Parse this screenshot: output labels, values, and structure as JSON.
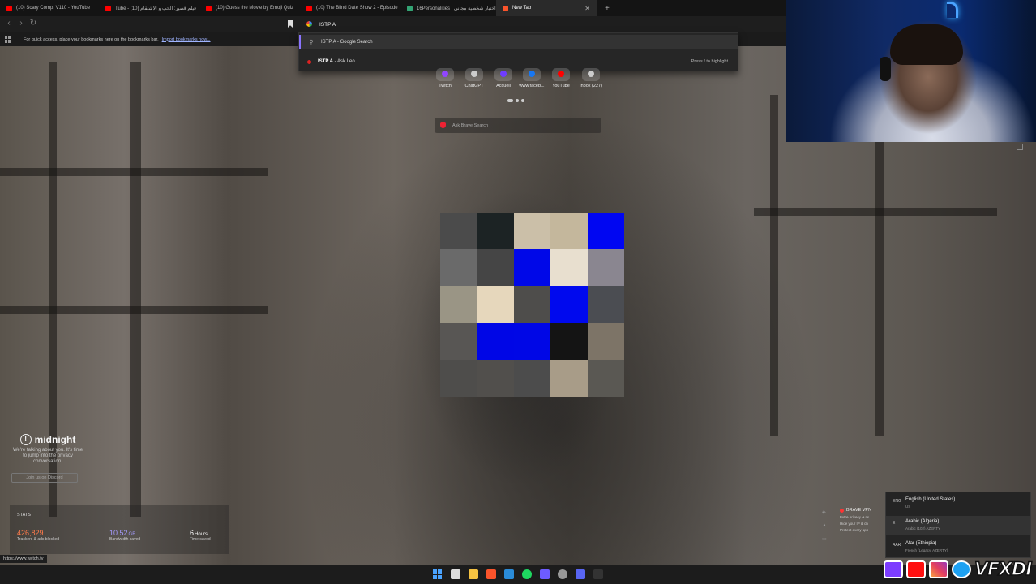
{
  "tabs": [
    {
      "label": "(10) Scary Comp. V110 - YouTube",
      "favicon_color": "#ff0000"
    },
    {
      "label": "Tube - فيلم قصير: الحب و الاشتقام (10)",
      "favicon_color": "#ff0000"
    },
    {
      "label": "(10) Guess the Movie by Emoji Quiz",
      "favicon_color": "#ff0000"
    },
    {
      "label": "(10) The Blind Date Show 2 - Episode",
      "favicon_color": "#ff0000"
    },
    {
      "label": "16Personalities | اختبار شخصية مجاني",
      "favicon_color": "#33a474"
    },
    {
      "label": "New Tab",
      "favicon_color": "#fb542b",
      "active": true
    }
  ],
  "toolbar": {
    "url_value": "ISTP A"
  },
  "bookmarks_bar": {
    "message": "For quick access, place your bookmarks here on the bookmarks bar.",
    "link": "Import bookmarks now..."
  },
  "omnibox": {
    "suggestion_1_bold": "ISTP A",
    "suggestion_1_rest": " - Google Search",
    "suggestion_2_bold": "ISTP A",
    "suggestion_2_rest": " - Ask Leo",
    "hint": "Press ! to highlight"
  },
  "top_sites": [
    {
      "label": "Twitch",
      "color": "#9146ff"
    },
    {
      "label": "ChatGPT",
      "color": "#cccccc"
    },
    {
      "label": "Accueil",
      "color": "#6f3cff"
    },
    {
      "label": "www.faceb...",
      "color": "#1877f2"
    },
    {
      "label": "YouTube",
      "color": "#ff0000"
    },
    {
      "label": "Inbox (227)",
      "color": "#cccccc"
    }
  ],
  "brave_search": {
    "placeholder": "Ask Brave Search"
  },
  "mosaic_colors": [
    "#4b4b4b",
    "#1c2324",
    "#cbbfa8",
    "#c4b79c",
    "#0006f2",
    "#6a6a6a",
    "#454545",
    "#0008e8",
    "#e8dfcf",
    "#8a8690",
    "#9a9585",
    "#e6d7bc",
    "#4e4d4b",
    "#0009ee",
    "#4b4d52",
    "#585654",
    "#0006e6",
    "#0007e6",
    "#141414",
    "#7d7467",
    "#4e4d4b",
    "#514f4c",
    "#4c4c4c",
    "#a89c88",
    "#5a5853"
  ],
  "midnight": {
    "title": "midnight",
    "text": "We're talking about you. It's time to jump into the privacy conversation.",
    "button": "Join us on Discord"
  },
  "stats": {
    "title": "STATS",
    "trackers": {
      "value": "426,829",
      "label": "Trackers & ads blocked"
    },
    "bandwidth": {
      "value": "10.52",
      "unit": "GB",
      "label": "Bandwidth saved"
    },
    "time": {
      "value": "6",
      "unit": "Hours",
      "label": "Time saved"
    }
  },
  "status_url": "https://www.twitch.tv",
  "vpn": {
    "title": "BRAVE VPN",
    "items": [
      "Extra privacy & se",
      "Hide your IP & ch",
      "Protect every app"
    ]
  },
  "languages": [
    {
      "code": "ENG",
      "name": "English (United States)",
      "keyboard": "US"
    },
    {
      "code": "E",
      "name": "Arabic (Algeria)",
      "keyboard": "Arabic (102) AZERTY"
    },
    {
      "code": "AAR",
      "name": "Afar (Ethiopia)",
      "keyboard": "French (Legacy, AZERTY)"
    }
  ],
  "brand": "VFXDI"
}
